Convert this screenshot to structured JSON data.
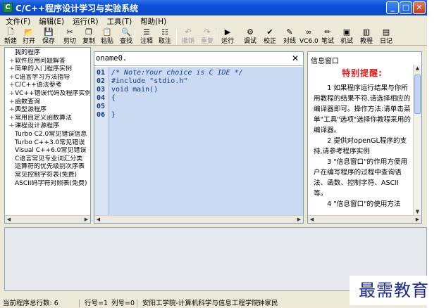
{
  "window": {
    "title": "C/C++程序设计学习与实验系统",
    "app_icon": "C",
    "controls": [
      "_",
      "□",
      "✕"
    ]
  },
  "menu": [
    "文件(F)",
    "编辑(E)",
    "运行(R)",
    "工具(T)",
    "帮助(H)"
  ],
  "toolbar": [
    {
      "label": "新建",
      "icon": "new-file-icon",
      "glyph": "🗋"
    },
    {
      "label": "打开",
      "icon": "open-folder-icon",
      "glyph": "📂"
    },
    {
      "label": "保存",
      "icon": "save-icon",
      "glyph": "💾"
    },
    {
      "label": "剪切",
      "icon": "cut-icon",
      "glyph": "✂"
    },
    {
      "label": "复制",
      "icon": "copy-icon",
      "glyph": "❐"
    },
    {
      "label": "粘贴",
      "icon": "paste-icon",
      "glyph": "📋"
    },
    {
      "label": "查找",
      "icon": "find-icon",
      "glyph": "🔍"
    },
    {
      "label": "注释",
      "icon": "comment-icon",
      "glyph": "☰"
    },
    {
      "label": "取注",
      "icon": "uncomment-icon",
      "glyph": "☷"
    },
    {
      "label": "撤销",
      "icon": "undo-icon",
      "glyph": "↶",
      "disabled": true
    },
    {
      "label": "重复",
      "icon": "redo-icon",
      "glyph": "↷",
      "disabled": true
    },
    {
      "label": "运行",
      "icon": "run-icon",
      "glyph": "▶"
    },
    {
      "label": "调试",
      "icon": "debug-icon",
      "glyph": "⚙"
    },
    {
      "label": "校正",
      "icon": "check-icon",
      "glyph": "✔"
    },
    {
      "label": "对线",
      "icon": "align-icon",
      "glyph": "✎"
    },
    {
      "label": "VC6.0",
      "icon": "vc6-icon",
      "glyph": "∞"
    },
    {
      "label": "笔试",
      "icon": "pen-icon",
      "glyph": "✏"
    },
    {
      "label": "机试",
      "icon": "computer-icon",
      "glyph": "▣"
    },
    {
      "label": "教程",
      "icon": "book-icon",
      "glyph": "▥"
    },
    {
      "label": "日记",
      "icon": "diary-icon",
      "glyph": "▤"
    }
  ],
  "tree": [
    {
      "label": "我的程序",
      "pm": ""
    },
    {
      "label": "软件应用问题解答",
      "pm": "+"
    },
    {
      "label": "简单的入门程序实例",
      "pm": "+"
    },
    {
      "label": "C语言学习方法指导",
      "pm": "+"
    },
    {
      "label": "C/C++语法参考",
      "pm": "+"
    },
    {
      "label": "VC++错误代码及程序实例",
      "pm": "+"
    },
    {
      "label": "函数查询",
      "pm": "+"
    },
    {
      "label": "典型源程序",
      "pm": "+"
    },
    {
      "label": "常用自定义函数算法",
      "pm": "+"
    },
    {
      "label": "课程设计源程序",
      "pm": "+"
    },
    {
      "label": "Turbo C2.0常见错误信息",
      "pm": ""
    },
    {
      "label": "Turbo C++3.0常见错误",
      "pm": ""
    },
    {
      "label": "Visual C++6.0常见错误",
      "pm": ""
    },
    {
      "label": "C语言常见专业词汇分类",
      "pm": ""
    },
    {
      "label": "运算符的优先级别次序表",
      "pm": ""
    },
    {
      "label": "常见控制字符表(免费)",
      "pm": ""
    },
    {
      "label": "ASCII码字符对照表(免费)",
      "pm": ""
    }
  ],
  "editor": {
    "tab_name": "oname0.",
    "close": "✕",
    "lines": [
      {
        "n": "01",
        "text": "/* Note:Your choice is C IDE */",
        "kind": "comment"
      },
      {
        "n": "02",
        "text": "#include \"stdio.h\"",
        "kind": "str"
      },
      {
        "n": "03",
        "text": "void main()",
        "kind": "code"
      },
      {
        "n": "04",
        "text": "{",
        "kind": "code"
      },
      {
        "n": "05",
        "text": "",
        "kind": "code"
      },
      {
        "n": "06",
        "text": "}",
        "kind": "code"
      }
    ]
  },
  "info": {
    "title": "信息窗口",
    "heading": "特别提醒:",
    "paragraphs": [
      "1 如果程序运行结果与你所用教程的结果不符,请选择相应的编译器即可。操作方法:请单击菜单\"工具\"选项\"选择你教程采用的编译器。",
      "2 提供对openGL程序的支持,请参考程序实例",
      "3 \"信息窗口\"的作用方便用户在编写程序的过程中查询语法、函数、控制字符、ASCII等。",
      "4 \"信息窗口\"的使用方法"
    ]
  },
  "statusbar": {
    "count": "当前程序总行数: 6",
    "row": "行号=1",
    "col": "列号=0",
    "org": "安阳工学院-计算机科学与信息工程学院",
    "author": "钟家民"
  },
  "watermark": "最需教育"
}
